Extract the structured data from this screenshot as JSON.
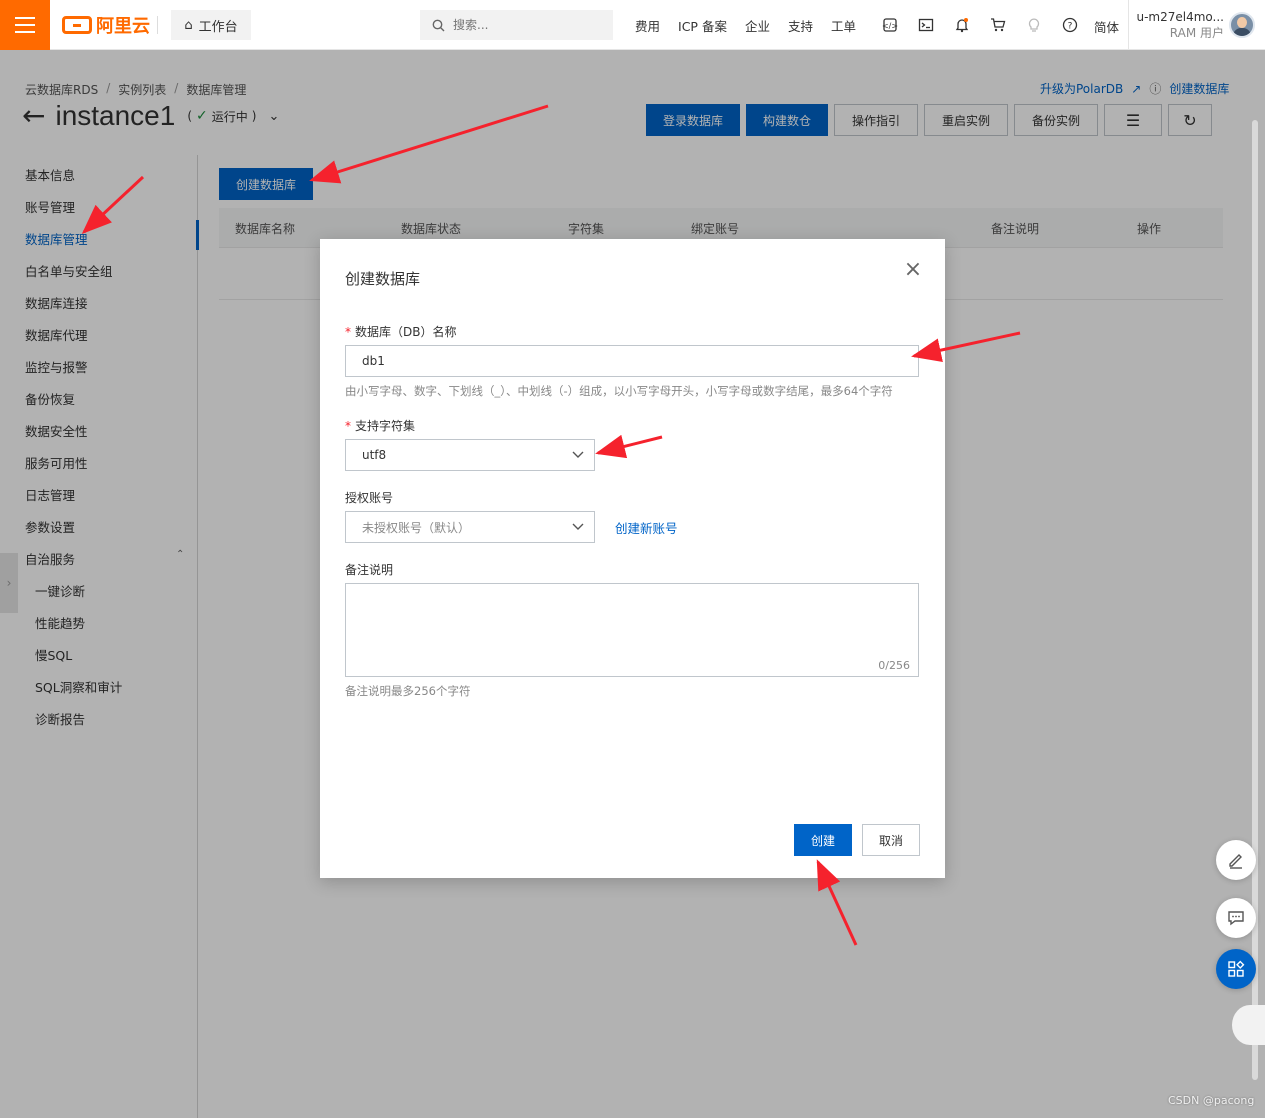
{
  "topbar": {
    "brand": "阿里云",
    "workbench": "工作台",
    "search_placeholder": "搜索...",
    "nav": [
      "费用",
      "ICP 备案",
      "企业",
      "支持",
      "工单"
    ],
    "icons": [
      "code-icon",
      "terminal-icon",
      "bell-icon",
      "cart-icon",
      "bulb-icon",
      "help-icon"
    ],
    "language": "简体",
    "user_name": "u-m27el4mo...",
    "user_role": "RAM 用户"
  },
  "breadcrumb": [
    "云数据库RDS",
    "实例列表",
    "数据库管理"
  ],
  "header": {
    "instance_name": "instance1",
    "status_open": "(",
    "status": "运行中",
    "status_close": ")",
    "upgrade_link": "升级为PolarDB",
    "create_db_link": "创建数据库"
  },
  "actions": [
    "登录数据库",
    "构建数仓",
    "操作指引",
    "重启实例",
    "备份实例"
  ],
  "sidebar": {
    "items": [
      "基本信息",
      "账号管理",
      "数据库管理",
      "白名单与安全组",
      "数据库连接",
      "数据库代理",
      "监控与报警",
      "备份恢复",
      "数据安全性",
      "服务可用性",
      "日志管理",
      "参数设置",
      "自治服务"
    ],
    "sub_items": [
      "一键诊断",
      "性能趋势",
      "慢SQL",
      "SQL洞察和审计",
      "诊断报告"
    ]
  },
  "main": {
    "create_button": "创建数据库",
    "columns": [
      "数据库名称",
      "数据库状态",
      "字符集",
      "绑定账号",
      "备注说明",
      "操作"
    ]
  },
  "dialog": {
    "title": "创建数据库",
    "db_name_label": "数据库（DB）名称",
    "db_name_value": "db1",
    "db_name_hint": "由小写字母、数字、下划线（_）、中划线（-）组成，以小写字母开头，小写字母或数字结尾，最多64个字符",
    "charset_label": "支持字符集",
    "charset_value": "utf8",
    "account_label": "授权账号",
    "account_value": "未授权账号（默认）",
    "create_account_link": "创建新账号",
    "remark_label": "备注说明",
    "remark_counter": "0/256",
    "remark_hint": "备注说明最多256个字符",
    "ok": "创建",
    "cancel": "取消"
  },
  "watermark": "CSDN @pacong",
  "colors": {
    "brand": "#ff6a00",
    "primary": "#0064c8",
    "annotation_arrow": "#f5222d"
  }
}
